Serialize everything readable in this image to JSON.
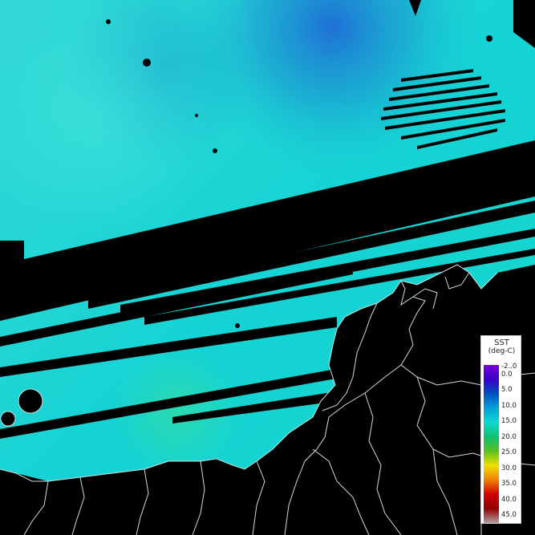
{
  "map": {
    "colors": {
      "ocean_base": "#18d6d6",
      "ocean_light": "#3fe2d8",
      "ocean_deep": "#0a9fcf",
      "ocean_blue": "#1d6fd6",
      "ocean_warm": "#2fe0a8",
      "land": "#000000",
      "no_data": "#000000",
      "border": "#d8d8d8"
    }
  },
  "legend": {
    "title": "SST",
    "unit": "(deg-C)",
    "ticks": [
      "-2..0",
      "0.0",
      "5.0",
      "10.0",
      "15.0",
      "20.0",
      "25.0",
      "30.0",
      "35.0",
      "40.0",
      "45.0"
    ],
    "gradient": [
      "#7a00d8",
      "#3a00c8",
      "#0050c0",
      "#00a0d8",
      "#10d8d0",
      "#10c070",
      "#58c020",
      "#f0e000",
      "#f08000",
      "#d00000",
      "#900000",
      "#b0a0a0"
    ]
  }
}
